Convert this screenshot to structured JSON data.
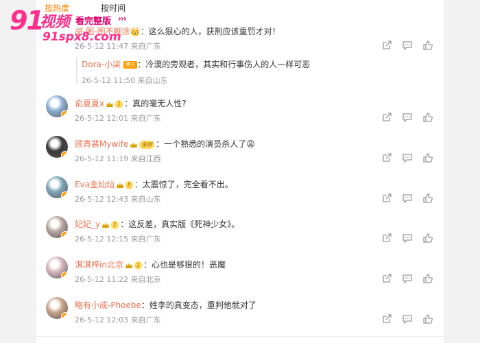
{
  "tabs": {
    "hot": "按热度",
    "time": "按时间"
  },
  "watermark": {
    "brand_num": "91",
    "brand_text": "视频",
    "tagline": "看完整版",
    "arrows": "›››",
    "url": "91spx8.com"
  },
  "top_comment": {
    "user": "胡-图-图不糊涂",
    "text": "：这么狠心的人，获刑应该重罚才对！",
    "meta": "26-5-12 11:47 来自广东",
    "reply": {
      "user": "Dora-小柒",
      "tag": "博主",
      "text": "：冷漠的旁观者，其实和行事伤人的人一样可恶",
      "meta": "26-5-12 11:50 来自山东"
    }
  },
  "comments": [
    {
      "user": "俞夏夏x",
      "vip": "1",
      "text": "：真的毫无人性?",
      "meta": "26-5-12 12:01 来自广东",
      "avatar_color": "#8fb0d4"
    },
    {
      "user": "顾青裴Mywife",
      "vip": "金标",
      "text": "：一个熟悉的演员杀人了😩",
      "meta": "26-5-12 11:19 来自江西",
      "avatar_color": "#3a3a3a"
    },
    {
      "user": "Eva金灿灿",
      "vip": "II",
      "text": "：太震惊了，完全看不出。",
      "meta": "26-5-12 12:43 来自山东",
      "avatar_color": "#7fa6b8"
    },
    {
      "user": "妃妃_y",
      "vip": "1",
      "text": "：这反差，真实版《死神少女》。",
      "meta": "26-5-12 12:15 来自广东",
      "avatar_color": "#b9a7a2"
    },
    {
      "user": "淇淇梓in北京",
      "vip": "1",
      "text": "：心也是够狠的！恶魔",
      "meta": "26-5-12 11:22 来自北京",
      "avatar_color": "#d6b7c0"
    },
    {
      "user": "略有小成-Phoebe",
      "vip": "",
      "text": "：姓李的真变态，重判他就对了",
      "meta": "26-5-12 12:03 来自广东",
      "avatar_color": "#c9a58a"
    }
  ],
  "icons": {
    "forward": "share-icon",
    "comment": "comment-icon",
    "like": "like-icon"
  },
  "colors": {
    "username": "#eb7350",
    "meta": "#999999",
    "active_tab": "#ff8200"
  }
}
